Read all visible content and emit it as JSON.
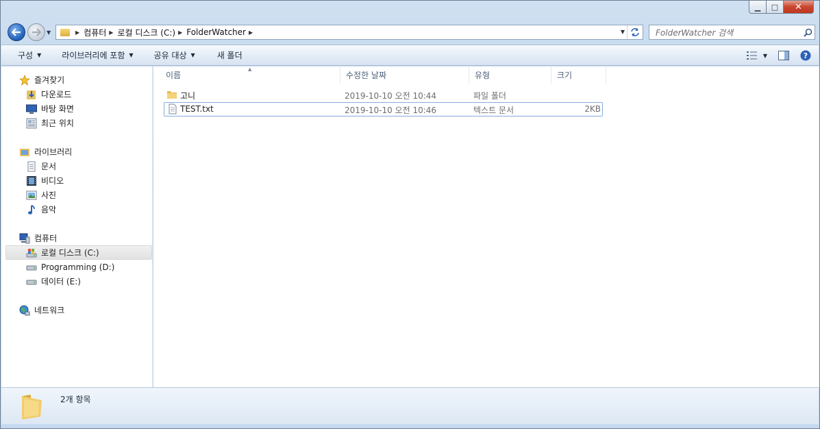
{
  "window": {
    "minimize": "▁",
    "maximize": "□",
    "close": "✕"
  },
  "address": {
    "crumbs": [
      "컴퓨터",
      "로컬 디스크 (C:)",
      "FolderWatcher"
    ],
    "search_placeholder": "FolderWatcher 검색"
  },
  "toolbar": {
    "organize": "구성",
    "include_library": "라이브러리에 포함",
    "share": "공유 대상",
    "new_folder": "새 폴더"
  },
  "sidebar": {
    "favorites": {
      "label": "즐겨찾기",
      "items": [
        "다운로드",
        "바탕 화면",
        "최근 위치"
      ]
    },
    "libraries": {
      "label": "라이브러리",
      "items": [
        "문서",
        "비디오",
        "사진",
        "음악"
      ]
    },
    "computer": {
      "label": "컴퓨터",
      "items": [
        "로컬 디스크 (C:)",
        "Programming (D:)",
        "데이터 (E:)"
      ],
      "selected": "로컬 디스크 (C:)"
    },
    "network": {
      "label": "네트워크"
    }
  },
  "columns": {
    "name": "이름",
    "date": "수정한 날짜",
    "type": "유형",
    "size": "크기"
  },
  "files": [
    {
      "name": "고니",
      "date": "2019-10-10 오전 10:44",
      "type": "파일 폴더",
      "size": "",
      "icon": "folder-icon"
    },
    {
      "name": "TEST.txt",
      "date": "2019-10-10 오전 10:46",
      "type": "텍스트 문서",
      "size": "2KB",
      "icon": "text-file-icon"
    }
  ],
  "details": {
    "count": "2개 항목"
  }
}
